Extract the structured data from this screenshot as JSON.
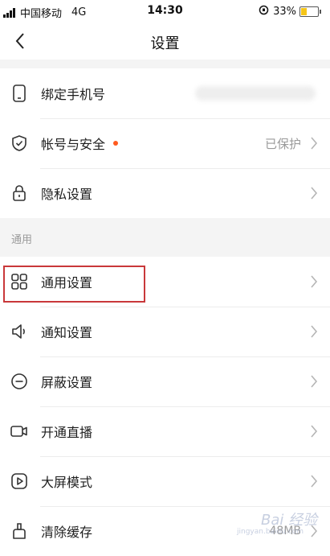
{
  "status_bar": {
    "carrier": "中国移动",
    "network": "4G",
    "time": "14:30",
    "battery": "33%",
    "battery_level": 0.33,
    "battery_color": "#f5c518"
  },
  "nav": {
    "title": "设置",
    "back_icon": "chevron-left-icon"
  },
  "account_group": [
    {
      "label": "绑定手机号",
      "icon": "phone-icon",
      "value": "",
      "value_obscured": true
    },
    {
      "label": "帐号与安全",
      "icon": "shield-icon",
      "value": "已保护",
      "has_dot": true
    },
    {
      "label": "隐私设置",
      "icon": "lock-icon",
      "value": ""
    }
  ],
  "general_section": {
    "header": "通用",
    "items": [
      {
        "label": "通用设置",
        "icon": "grid-icon",
        "value": "",
        "highlighted": true
      },
      {
        "label": "通知设置",
        "icon": "speaker-icon",
        "value": ""
      },
      {
        "label": "屏蔽设置",
        "icon": "block-icon",
        "value": ""
      },
      {
        "label": "开通直播",
        "icon": "video-camera-icon",
        "value": ""
      },
      {
        "label": "大屏模式",
        "icon": "play-icon",
        "value": ""
      },
      {
        "label": "清除缓存",
        "icon": "broom-icon",
        "value": "48MB"
      }
    ]
  },
  "watermark": {
    "text": "Bai 经验",
    "sub": "jingyan.baidu.com"
  },
  "colors": {
    "accent_dot": "#ff5a1f",
    "highlight_border": "#c9383a",
    "secondary_text": "#9a9a9a"
  }
}
